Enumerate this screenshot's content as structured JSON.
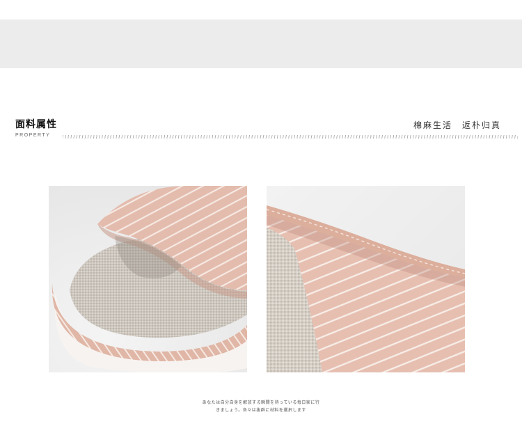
{
  "header": {
    "title_cn": "面料属性",
    "title_en": "PROPERTY",
    "slogan_left": "棉麻生活",
    "slogan_right": "返朴归真"
  },
  "photos": [
    {
      "name": "slipper-front-closeup"
    },
    {
      "name": "slipper-fabric-closeup"
    }
  ],
  "caption": {
    "line1": "あなたは自分自身を解放する瞬間を待っている每日家に行",
    "line2": "きましょう。各々は抜群に材料を選択します"
  },
  "colors": {
    "band": "#ececec",
    "fabric_pink": "#e7c3b7",
    "stripe": "#f7ece6",
    "linen": "#cfc9c1"
  }
}
